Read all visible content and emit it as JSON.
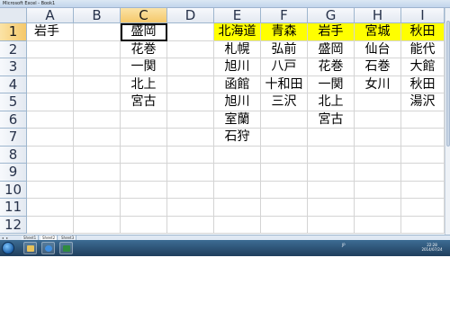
{
  "window": {
    "title": "Microsoft Excel - Book1"
  },
  "sheet": {
    "columns": [
      "A",
      "B",
      "C",
      "D",
      "E",
      "F",
      "G",
      "H",
      "I"
    ],
    "rows": [
      "1",
      "2",
      "3",
      "4",
      "5",
      "6",
      "7",
      "8",
      "9",
      "10",
      "11",
      "12"
    ],
    "active_column": "C",
    "active_row": "1",
    "cells": {
      "A1": "岩手",
      "C1": "盛岡",
      "C2": "花巻",
      "C3": "一関",
      "C4": "北上",
      "C5": "宮古",
      "E1": "北海道",
      "E2": "札幌",
      "E3": "旭川",
      "E4": "函館",
      "E5": "旭川",
      "E6": "室蘭",
      "E7": "石狩",
      "F1": "青森",
      "F2": "弘前",
      "F3": "八戸",
      "F4": "十和田",
      "F5": "三沢",
      "G1": "岩手",
      "G2": "盛岡",
      "G3": "花巻",
      "G4": "一関",
      "G5": "北上",
      "G6": "宮古",
      "H1": "宮城",
      "H2": "仙台",
      "H3": "石巻",
      "H4": "女川",
      "I1": "秋田",
      "I2": "能代",
      "I3": "大館",
      "I4": "秋田",
      "I5": "湯沢"
    },
    "highlight_color": "#ffff00",
    "selected_cell": "C1"
  },
  "tabs": [
    "Sheet1",
    "Sheet2",
    "Sheet3"
  ],
  "active_tab": "Sheet2",
  "taskbar": {
    "icons": [
      "start-orb-icon",
      "explorer-icon",
      "ie-icon",
      "excel-icon"
    ],
    "tray_text": "JP",
    "clock_time": "22:28",
    "clock_date": "2014/07/24"
  }
}
